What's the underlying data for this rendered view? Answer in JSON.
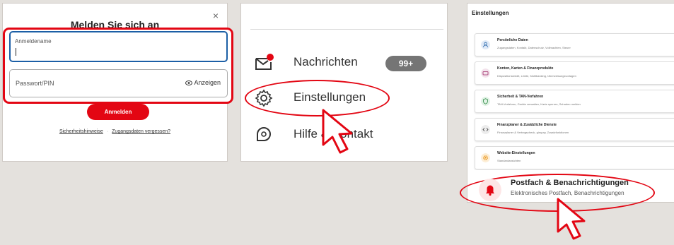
{
  "login": {
    "close": "×",
    "title": "Melden Sie sich an",
    "username_label": "Anmeldename",
    "password_label": "Passwort/PIN",
    "show_label": "Anzeigen",
    "login_button": "Anmelden",
    "link_security": "Sicherheitshinweise",
    "link_separator": "·",
    "link_forgot": "Zugangsdaten vergessen?"
  },
  "menu": {
    "items": [
      {
        "label": "Nachrichten",
        "badge": "99+",
        "icon": "envelope-icon"
      },
      {
        "label": "Einstellungen",
        "icon": "gear-icon"
      },
      {
        "label": "Hilfe & Kontakt",
        "icon": "chat-help-icon"
      }
    ]
  },
  "settings": {
    "heading": "Einstellungen",
    "cards": [
      {
        "title": "Persönliche Daten",
        "subtitle": "Zugangsdaten, Kontakt, Datenschutz, Vollmachten, Steuer",
        "icon": "person-icon",
        "color": "#dfe9f7"
      },
      {
        "title": "Konten, Karten & Finanzprodukte",
        "subtitle": "Dispositionskredit, Limite, Multibanking, Überweisungsvorlagen",
        "icon": "card-icon",
        "color": "#f3e3ec"
      },
      {
        "title": "Sicherheit & TAN-Verfahren",
        "subtitle": "TAN-Verfahren, Geräte verwalten, Karte sperren, Schaden melden",
        "icon": "shield-icon",
        "color": "#e1f2e5"
      },
      {
        "title": "Finanzplaner & Zusätzliche Dienste",
        "subtitle": "Finanzplaner & Vertragscheck, giropay, Zusatzfunktionen",
        "icon": "code-icon",
        "color": "#ececec"
      },
      {
        "title": "Website-Einstellungen",
        "subtitle": "Standardansichten",
        "icon": "gear-icon",
        "color": "#fdeed6"
      }
    ],
    "highlight": {
      "title": "Postfach & Benachrichtigungen",
      "subtitle": "Elektronisches Postfach, Benachrichtigungen",
      "icon": "bell-icon"
    }
  },
  "colors": {
    "accent": "#e30613",
    "focus": "#1c5fa6"
  }
}
